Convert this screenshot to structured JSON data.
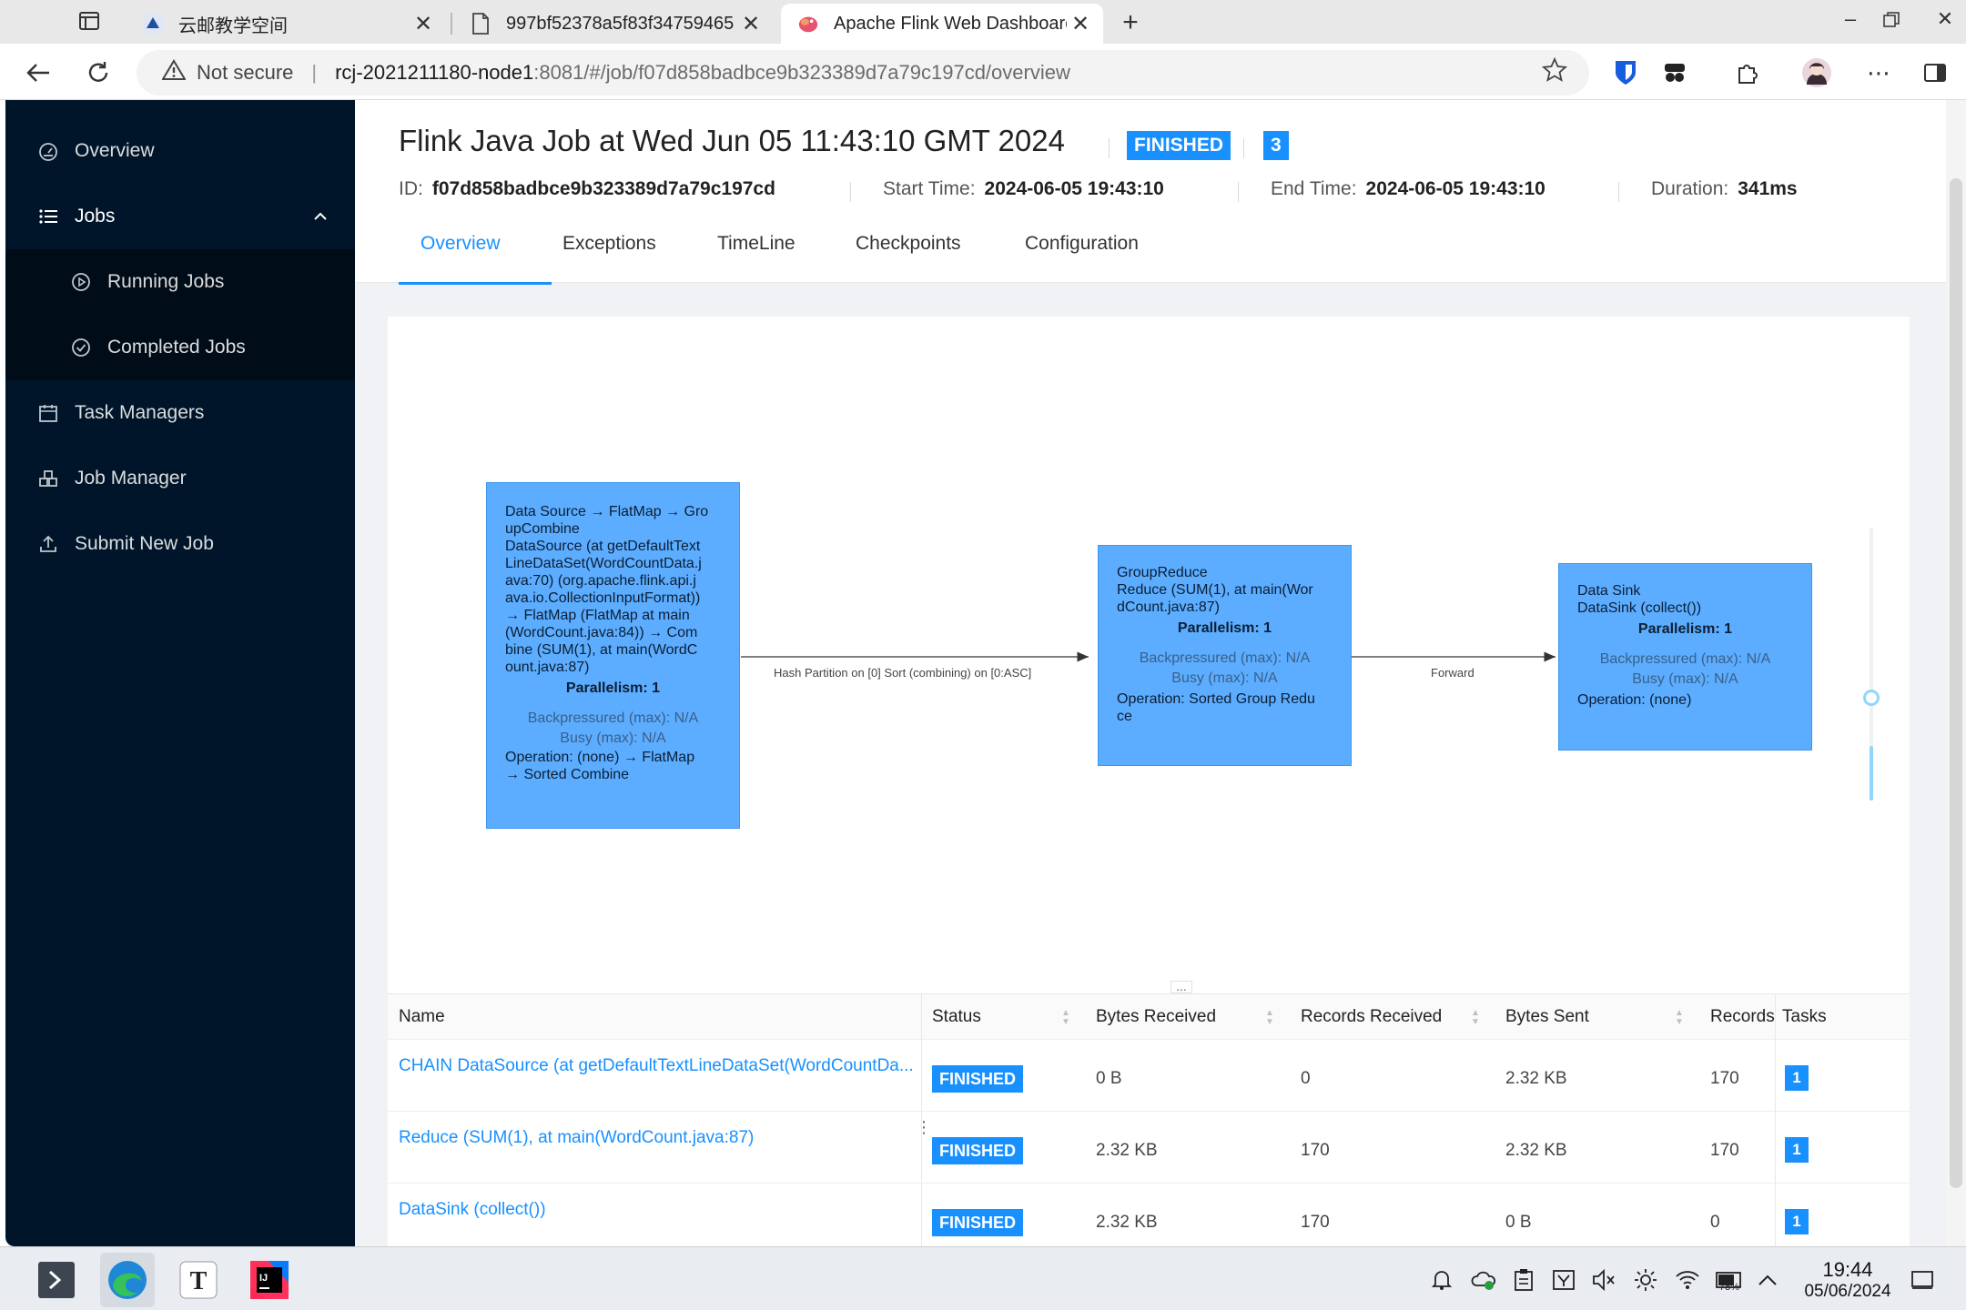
{
  "browser": {
    "tabs": [
      {
        "title": "云邮教学空间"
      },
      {
        "title": "997bf52378a5f83f34759465"
      },
      {
        "title": "Apache Flink Web Dashboard"
      }
    ],
    "address": {
      "security": "Not secure",
      "host": "rcj-2021211180-node1",
      "path": ":8081/#/job/f07d858badbce9b323389d7a79c197cd/overview"
    }
  },
  "sidebar": {
    "items": [
      {
        "label": "Overview"
      },
      {
        "label": "Jobs"
      },
      {
        "label": "Running Jobs"
      },
      {
        "label": "Completed Jobs"
      },
      {
        "label": "Task Managers"
      },
      {
        "label": "Job Manager"
      },
      {
        "label": "Submit New Job"
      }
    ]
  },
  "job": {
    "title": "Flink Java Job at Wed Jun 05 11:43:10 GMT 2024",
    "status": "FINISHED",
    "task_count": "3",
    "id_label": "ID:",
    "id": "f07d858badbce9b323389d7a79c197cd",
    "start_label": "Start Time:",
    "start": "2024-06-05 19:43:10",
    "end_label": "End Time:",
    "end": "2024-06-05 19:43:10",
    "duration_label": "Duration:",
    "duration": "341ms",
    "tabs": [
      "Overview",
      "Exceptions",
      "TimeLine",
      "Checkpoints",
      "Configuration"
    ]
  },
  "graph": {
    "nodes": [
      {
        "lines": [
          "Data Source → FlatMap → Gro",
          "upCombine",
          "DataSource (at getDefaultText",
          "LineDataSet(WordCountData.j",
          "ava:70) (org.apache.flink.api.j",
          "ava.io.CollectionInputFormat))",
          "→ FlatMap (FlatMap at main",
          "(WordCount.java:84)) → Com",
          "bine (SUM(1), at main(WordC",
          "ount.java:87)"
        ],
        "parallelism": "Parallelism: 1",
        "backpressured": "Backpressured (max): N/A",
        "busy": "Busy (max): N/A",
        "operation": [
          "Operation: (none) → FlatMap",
          "→ Sorted Combine"
        ]
      },
      {
        "lines": [
          "GroupReduce",
          "Reduce (SUM(1), at main(Wor",
          "dCount.java:87)"
        ],
        "parallelism": "Parallelism: 1",
        "backpressured": "Backpressured (max): N/A",
        "busy": "Busy (max): N/A",
        "operation": [
          "Operation: Sorted Group Redu",
          "ce"
        ]
      },
      {
        "lines": [
          "Data Sink",
          "DataSink (collect())"
        ],
        "parallelism": "Parallelism: 1",
        "backpressured": "Backpressured (max): N/A",
        "busy": "Busy (max): N/A",
        "operation": [
          "Operation: (none)"
        ]
      }
    ],
    "edges": [
      {
        "label": "Hash Partition on [0] Sort (combining) on [0:ASC]"
      },
      {
        "label": "Forward"
      }
    ],
    "divider_handle": "..."
  },
  "table": {
    "headers": [
      "Name",
      "Status",
      "Bytes Received",
      "Records Received",
      "Bytes Sent",
      "Records",
      "Tasks"
    ],
    "rows": [
      {
        "name": "CHAIN DataSource (at getDefaultTextLineDataSet(WordCountDa...",
        "status": "FINISHED",
        "bytes_received": "0 B",
        "records_received": "0",
        "bytes_sent": "2.32 KB",
        "records_sent": "170",
        "tasks": "1"
      },
      {
        "name": "Reduce (SUM(1), at main(WordCount.java:87)",
        "status": "FINISHED",
        "bytes_received": "2.32 KB",
        "records_received": "170",
        "bytes_sent": "2.32 KB",
        "records_sent": "170",
        "tasks": "1"
      },
      {
        "name": "DataSink (collect())",
        "status": "FINISHED",
        "bytes_received": "2.32 KB",
        "records_received": "170",
        "bytes_sent": "0 B",
        "records_sent": "0",
        "tasks": "1"
      }
    ]
  },
  "taskbar": {
    "time": "19:44",
    "date": "05/06/2024",
    "battery": "78%"
  },
  "colors": {
    "sidebar": "#001529",
    "accent": "#1890ff",
    "node_fill": "#5cadff"
  }
}
